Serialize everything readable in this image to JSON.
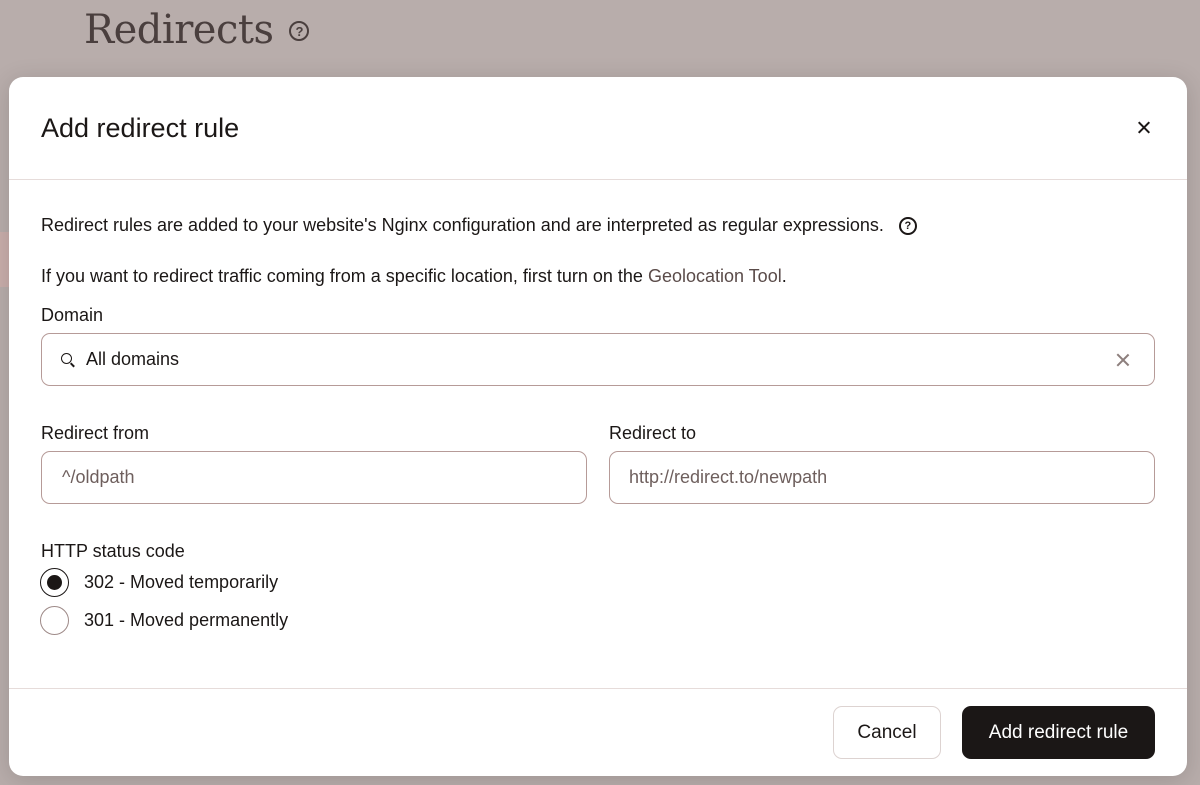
{
  "page": {
    "title": "Redirects"
  },
  "modal": {
    "title": "Add redirect rule",
    "intro_text": "Redirect rules are added to your website's Nginx configuration and are interpreted as regular expressions.",
    "geo_text_prefix": "If you want to redirect traffic coming from a specific location, first turn on the ",
    "geo_link": "Geolocation Tool",
    "geo_text_suffix": ".",
    "domain": {
      "label": "Domain",
      "value": "All domains"
    },
    "redirect_from": {
      "label": "Redirect from",
      "placeholder": "^/oldpath"
    },
    "redirect_to": {
      "label": "Redirect to",
      "placeholder": "http://redirect.to/newpath"
    },
    "status_code": {
      "label": "HTTP status code",
      "options": [
        {
          "label": "302 - Moved temporarily",
          "selected": true
        },
        {
          "label": "301 - Moved permanently",
          "selected": false
        }
      ]
    },
    "cancel_label": "Cancel",
    "submit_label": "Add redirect rule"
  },
  "icons": {
    "help": "help-circle-icon",
    "close": "close-icon",
    "search": "search-icon",
    "clear": "clear-icon"
  },
  "colors": {
    "overlay": "#b8adab",
    "primary_button": "#1b1716",
    "field_border": "#b69b98",
    "link": "#5a4b49"
  }
}
